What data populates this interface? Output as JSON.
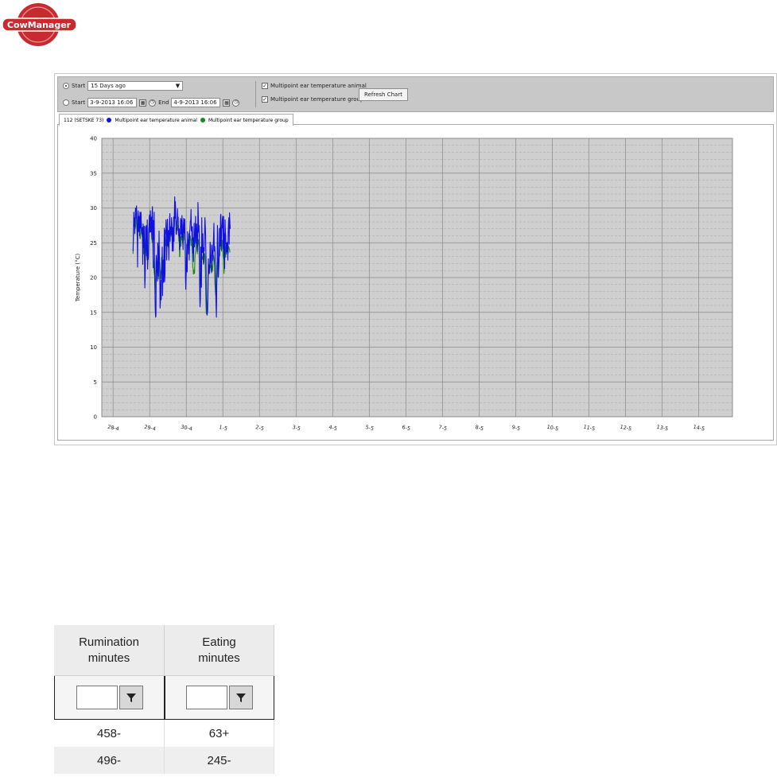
{
  "brand": {
    "logo_text": "CowManager",
    "accent_color": "#c72a2f"
  },
  "toolbar": {
    "mode_start_label": "Start",
    "mode_range_start_label": "Start",
    "range_end_label": "End",
    "preset_value": "15 Days ago",
    "start_datetime": "3-9-2013 16:06",
    "end_datetime": "4-9-2013 16:06",
    "checkbox_animal_label": "Multipoint ear temperature animal",
    "checkbox_group_label": "Multipoint ear temperature group",
    "refresh_button_label": "Refresh Chart",
    "icons": [
      "calendar-icon",
      "clock-icon"
    ]
  },
  "chart_tab": {
    "title": "112 (SETSKE 73)",
    "legend_animal": "Multipoint ear temperature animal",
    "legend_group": "Multipoint ear temperature group"
  },
  "chart_data": {
    "type": "line",
    "title": "",
    "xlabel": "",
    "ylabel": "Temperature (°C)",
    "ylim": [
      0,
      40
    ],
    "y_ticks": [
      "0",
      "5",
      "10",
      "15",
      "20",
      "25",
      "30",
      "35",
      "40"
    ],
    "grid": true,
    "x_ticks": [
      "28-4",
      "29-4",
      "30-4",
      "1-5",
      "2-5",
      "3-5",
      "4-5",
      "5-5",
      "6-5",
      "7-5",
      "8-5",
      "9-5",
      "10-5",
      "11-5",
      "12-5",
      "13-5",
      "14-5"
    ],
    "x_values": [
      0.35,
      0.6,
      0.85,
      1.1,
      1.35,
      1.6,
      1.85,
      2.1,
      2.35,
      2.6,
      2.85,
      3.1,
      3.35,
      3.6,
      3.85,
      4.1,
      4.35,
      4.6,
      4.85,
      5.1,
      5.35,
      5.6,
      5.85,
      6.1,
      6.35,
      6.6,
      6.85,
      7.1,
      7.35,
      7.6,
      7.85,
      8.1,
      8.35,
      8.6,
      8.85,
      9.1,
      9.35,
      9.6,
      9.85,
      10.1,
      10.35,
      10.6,
      10.85,
      11.1,
      11.35,
      11.6,
      11.85,
      12.1,
      12.35,
      12.6,
      12.85,
      13.1,
      13.35,
      13.6,
      13.85,
      14.1,
      14.35,
      14.6,
      14.85,
      15.1,
      15.35,
      15.6,
      15.85,
      16.1,
      16.35,
      16.6,
      16.85,
      17.1,
      17.35,
      17.6,
      17.85,
      18.1,
      18.35,
      18.6,
      18.85,
      19.1,
      19.35,
      19.6,
      19.85,
      20.1,
      20.35,
      20.6,
      20.85,
      21.1,
      21.35,
      21.6,
      21.85,
      22.1,
      22.35,
      22.6,
      22.85,
      23.1,
      23.35,
      23.6,
      23.85,
      24.1,
      24.35,
      24.6,
      24.85,
      25.1,
      25.35,
      25.6,
      25.85,
      26.1,
      26.35,
      26.6,
      26.85,
      27.1,
      27.35,
      27.6,
      27.85,
      28.1,
      28.35,
      28.6,
      28.85,
      29.1,
      29.35,
      29.6,
      29.85,
      30.1,
      30.35,
      30.6,
      30.85,
      31.1,
      31.35,
      31.6,
      31.85,
      32.1,
      32.35,
      32.6,
      32.85,
      33.1,
      33.35,
      33.6,
      33.85,
      34.1,
      34.35,
      34.6,
      34.85,
      35.1,
      35.35,
      35.6,
      35.85,
      36.1,
      36.35,
      36.6,
      36.85,
      37.1,
      37.35,
      37.6,
      37.85,
      38.1,
      38.35,
      38.6,
      38.85,
      39.1,
      39.35,
      39.6,
      39.85,
      40.1,
      40.35,
      40.6,
      40.85,
      41.1,
      41.35,
      41.6,
      41.85,
      42.1,
      42.35,
      42.6,
      42.85,
      43.1,
      43.35,
      43.6,
      43.85,
      44.1,
      44.35,
      44.6,
      44.85,
      45.1,
      45.35,
      45.6,
      45.85,
      46.1,
      46.35,
      46.6,
      46.85,
      47.1,
      47.35,
      47.6,
      47.85,
      48.1,
      48.35,
      48.6,
      48.85,
      49.1,
      49.35,
      49.6,
      49.85,
      50.1,
      50.35,
      50.6,
      50.85,
      51.1,
      51.35,
      51.6,
      51.85,
      52.1,
      52.35,
      52.6,
      52.85,
      53.1,
      53.35,
      53.6,
      53.85,
      54.1,
      54.35,
      54.6,
      54.85,
      55.1,
      55.35,
      55.6,
      55.85,
      56.1,
      56.35,
      56.6,
      56.85,
      57.1,
      57.35,
      57.6,
      57.85,
      58.1,
      58.35,
      58.6,
      58.85,
      59.1,
      59.35,
      59.6,
      59.85,
      60.1,
      60.35,
      60.6,
      60.85,
      61.1,
      61.35,
      61.6,
      61.85,
      62.1,
      62.35,
      62.6,
      62.85,
      63.1,
      63.35,
      63.6,
      63.85,
      64.1,
      64.35,
      64.6,
      64.85,
      65.1,
      65.35,
      65.6,
      65.85,
      66.1,
      66.35,
      66.6,
      66.85,
      67.1,
      67.35,
      67.6,
      67.85,
      68.1,
      68.35,
      68.6,
      68.85,
      69.1,
      69.35,
      69.6,
      69.85,
      70.1,
      70.35,
      70.6,
      70.85,
      71.1,
      71.35,
      71.6,
      71.85,
      72.1,
      72.35,
      72.6,
      72.85,
      73.1,
      73.35,
      73.6,
      73.85,
      74.1,
      74.35,
      74.6,
      74.85,
      75.1,
      75.35,
      75.6,
      75.85,
      76.1,
      76.35,
      76.6,
      76.85,
      77.1,
      77.35,
      77.6,
      77.85,
      78.1,
      78.35,
      78.6,
      78.85,
      79.1,
      79.35,
      79.6,
      79.85,
      80.1,
      80.35,
      80.6,
      80.85,
      81.1,
      81.35,
      81.6,
      81.85,
      82.1,
      82.35,
      82.6,
      82.85,
      83.1,
      83.35,
      83.6,
      83.85,
      84.1,
      84.35,
      84.6,
      84.85,
      85.1,
      85.35,
      85.6,
      85.85,
      86.1,
      86.35,
      86.6,
      86.85,
      87.1,
      87.35,
      87.6,
      87.85,
      88.1,
      88.35,
      88.6,
      88.85,
      89.1,
      89.35,
      89.6,
      89.85,
      90.1,
      90.35,
      90.6,
      90.85,
      91.1,
      91.35,
      91.6,
      91.85,
      92.1,
      92.35,
      92.6,
      92.85,
      93.1,
      93.35,
      93.6,
      93.85,
      94.1,
      94.35,
      94.6,
      94.85,
      95.1,
      95.35,
      95.6,
      95.85,
      96.1,
      96.35,
      96.6,
      96.85,
      97.1,
      97.35,
      97.6,
      97.85,
      98.1,
      98.35,
      98.6,
      98.85,
      99.1,
      99.35,
      99.6,
      99.85
    ],
    "series": [
      {
        "name": "Multipoint ear temperature animal",
        "color": "#1010e0",
        "values": [
          23.8,
          25.5,
          29.4,
          27.4,
          28.6,
          26.3,
          28.7,
          30.0,
          29.9,
          28.5,
          30.3,
          28.2,
          26.6,
          21.5,
          28.6,
          29.6,
          26.6,
          28.8,
          28.4,
          26.0,
          29.4,
          27.1,
          28.8,
          29.4,
          27.1,
          26.3,
          26.2,
          27.2,
          21.9,
          27.7,
          24.3,
          27.1,
          27.4,
          22.9,
          18.5,
          20.3,
          27.3,
          24.0,
          27.5,
          23.1,
          24.6,
          28.3,
          21.2,
          23.2,
          22.6,
          26.7,
          27.5,
          29.0,
          26.6,
          26.5,
          29.6,
          26.6,
          27.6,
          28.7,
          25.5,
          29.3,
          30.2,
          26.9,
          21.4,
          28.2,
          25.5,
          29.4,
          21.3,
          18.5,
          15.3,
          14.3,
          14.5,
          23.2,
          20.7,
          22.2,
          19.5,
          25.0,
          24.4,
          20.2,
          22.3,
          26.7,
          22.4,
          20.5,
          15.6,
          16.7,
          19.6,
          16.8,
          21.2,
          20.5,
          24.4,
          17.4,
          20.5,
          22.5,
          19.3,
          23.0,
          27.1,
          19.4,
          20.5,
          26.8,
          26.3,
          28.3,
          26.6,
          22.5,
          25.7,
          28.4,
          24.6,
          26.8,
          26.7,
          22.5,
          25.4,
          28.1,
          29.2,
          25.2,
          27.3,
          26.8,
          26.2,
          28.6,
          27.5,
          23.8,
          27.2,
          26.3,
          23.8,
          28.7,
          25.2,
          28.7,
          31.6,
          28.5,
          30.9,
          29.1,
          26.3,
          26.2,
          27.0,
          27.4,
          29.9,
          28.3,
          28.7,
          26.3,
          26.0,
          27.0,
          24.0,
          24.4,
          26.4,
          28.5,
          26.3,
          28.3,
          25.8,
          28.9,
          27.5,
          25.7,
          24.0,
          27.5,
          28.5,
          26.4,
          27.6,
          28.4,
          25.1,
          20.2,
          18.3,
          20.3,
          22.4,
          24.8,
          20.8,
          26.6,
          24.5,
          25.4,
          23.4,
          26.3,
          22.5,
          26.6,
          27.0,
          28.1,
          28.2,
          29.8,
          26.7,
          27.3,
          25.4,
          27.3,
          23.5,
          25.7,
          22.3,
          25.0,
          27.8,
          24.4,
          25.1,
          26.7,
          28.8,
          24.9,
          26.3,
          27.7,
          26.6,
          23.7,
          24.5,
          30.8,
          28.8,
          26.5,
          27.5,
          25.5,
          19.6,
          15.8,
          17.0,
          24.4,
          21.1,
          18.6,
          28.6,
          24.3,
          23.6,
          26.3,
          22.6,
          21.9,
          24.3,
          23.8,
          26.0,
          28.6,
          27.5,
          26.2,
          22.7,
          17.1,
          16.3,
          14.6,
          14.8,
          15.3,
          18.4,
          22.7,
          20.6,
          21.8,
          20.6,
          21.8,
          25.1,
          24.6,
          22.1,
          23.2,
          20.7,
          24.7,
          23.9,
          23.7,
          22.4,
          24.3,
          26.3,
          27.8,
          23.8,
          24.5,
          23.8,
          19.6,
          18.3,
          16.3,
          14.3,
          18.8,
          20.4,
          27.5,
          26.4,
          23.6,
          20.1,
          21.3,
          22.6,
          27.0,
          27.1,
          24.5,
          28.8,
          29.1,
          24.0,
          27.1,
          27.1,
          28.3,
          28.8,
          25.5,
          24.1,
          28.8,
          22.7,
          26.3,
          21.3,
          28.3,
          26.7,
          26.0,
          23.4,
          25.0,
          23.7,
          24.3,
          25.1,
          22.5,
          26.4,
          27.8,
          28.6,
          24.8,
          29.3,
          27.8,
          27.0
        ],
        "x_scale_note": ""
      },
      {
        "name": "Multipoint ear temperature group",
        "color": "#1a8a1a",
        "values": [
          23.4,
          26.2,
          27.8,
          28.1,
          27.6,
          27.3,
          27.0,
          27.3,
          28.4,
          28.5,
          28.3,
          26.8,
          25.8,
          26.6,
          27.6,
          28.1,
          28.0,
          27.3,
          26.8,
          26.3,
          25.6,
          25.6,
          27.0,
          27.5,
          27.8,
          26.7,
          25.9,
          26.1,
          24.9,
          24.7,
          23.4,
          25.1,
          26.2,
          25.0,
          22.8,
          23.9,
          25.8,
          24.2,
          23.6,
          23.4,
          22.5,
          24.7,
          23.3,
          22.9,
          22.7,
          23.8,
          26.6,
          28.0,
          27.1,
          26.6,
          27.8,
          27.4,
          27.1,
          26.5,
          26.0,
          25.1,
          26.7,
          25.3,
          22.9,
          22.5,
          21.4,
          20.7,
          20.3,
          18.8,
          17.7,
          20.2,
          22.0,
          23.1,
          22.1,
          22.4,
          20.4,
          20.9,
          21.3,
          19.8,
          21.1,
          22.8,
          22.2,
          22.1,
          20.3,
          19.8,
          20.9,
          20.8,
          22.9,
          22.3,
          23.3,
          20.5,
          21.2,
          22.2,
          22.1,
          23.1,
          24.1,
          24.9,
          25.8,
          25.9,
          24.6,
          25.4,
          24.8,
          24.2,
          25.4,
          26.1,
          25.3,
          24.4,
          25.2,
          24.1,
          25.3,
          26.4,
          27.3,
          26.2,
          26.5,
          26.6,
          25.9,
          27.1,
          27.0,
          25.9,
          26.5,
          26.9,
          26.4,
          26.3,
          27.1,
          27.3,
          29.0,
          29.6,
          28.6,
          28.5,
          27.5,
          28.0,
          28.1,
          26.9,
          26.8,
          27.2,
          27.6,
          26.2,
          25.2,
          25.3,
          23.0,
          23.0,
          25.9,
          25.9,
          24.5,
          25.8,
          25.4,
          26.5,
          25.8,
          24.9,
          25.0,
          25.9,
          26.8,
          26.3,
          25.4,
          25.7,
          25.2,
          23.2,
          21.1,
          21.3,
          22.2,
          23.4,
          22.2,
          24.7,
          24.5,
          25.4,
          24.1,
          24.4,
          23.8,
          25.2,
          25.8,
          26.0,
          25.3,
          24.6,
          24.7,
          25.6,
          24.4,
          23.3,
          21.5,
          21.4,
          20.5,
          20.6,
          21.1,
          20.6,
          22.6,
          23.4,
          23.8,
          24.0,
          25.0,
          25.2,
          26.0,
          23.4,
          24.4,
          25.4,
          24.8,
          25.5,
          24.3,
          21.9,
          17.6,
          16.3,
          19.9,
          20.5,
          19.2,
          22.6,
          22.8,
          23.1,
          22.6,
          22.6,
          23.0,
          22.2,
          22.1,
          23.0,
          23.5,
          23.1,
          21.9,
          19.1,
          16.0,
          14.8,
          15.2,
          15.0,
          15.3,
          17.4,
          20.4,
          20.3,
          21.5,
          20.8,
          21.1,
          22.0,
          22.5,
          21.4,
          21.6,
          20.9,
          22.1,
          21.7,
          21.4,
          20.9,
          21.8,
          22.7,
          23.2,
          22.8,
          22.5,
          21.7,
          19.2,
          18.3,
          17.5,
          18.6,
          20.3,
          21.6,
          22.2,
          22.7,
          21.4,
          20.0,
          20.8,
          21.7,
          23.4,
          23.9,
          23.1,
          25.3,
          25.5,
          24.6,
          24.5,
          23.8,
          25.4,
          25.3,
          24.8,
          23.1,
          24.0,
          22.7,
          20.6,
          21.3,
          23.9,
          24.4,
          23.3,
          22.9,
          24.1,
          23.9,
          24.3,
          24.9,
          23.4,
          24.3,
          23.5,
          24.5,
          24.4,
          24.2,
          24.0,
          23.6
        ]
      }
    ]
  },
  "table": {
    "headers": [
      {
        "line1": "Rumination",
        "line2": "minutes"
      },
      {
        "line1": "Eating",
        "line2": "minutes"
      }
    ],
    "filter_placeholder": "",
    "rows": [
      [
        "458-",
        "63+"
      ],
      [
        "496-",
        "245-"
      ]
    ]
  }
}
